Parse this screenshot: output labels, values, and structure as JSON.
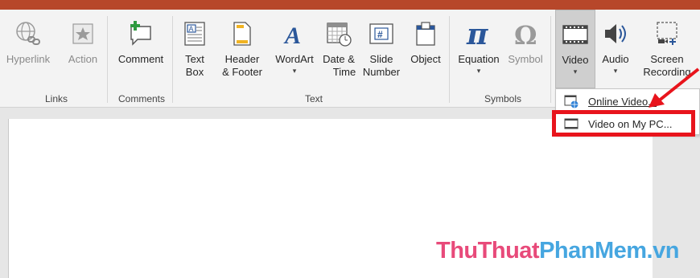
{
  "ribbon": {
    "groups": {
      "links": "Links",
      "comments": "Comments",
      "text": "Text",
      "symbols": "Symbols"
    },
    "buttons": {
      "hyperlink": "Hyperlink",
      "action": "Action",
      "comment": "Comment",
      "textbox_line1": "Text",
      "textbox_line2": "Box",
      "header_line1": "Header",
      "header_line2": "& Footer",
      "wordart": "WordArt",
      "datetime_line1": "Date &",
      "datetime_line2": "Time",
      "slidenumber_line1": "Slide",
      "slidenumber_line2": "Number",
      "object": "Object",
      "equation": "Equation",
      "symbol": "Symbol",
      "video": "Video",
      "audio": "Audio",
      "screen_line1": "Screen",
      "screen_line2": "Recording",
      "caret": "▾"
    },
    "colors": {
      "accent": "#b7472a",
      "wordart_blue": "#2b579a",
      "equation_blue": "#2b579a",
      "highlight_red": "#e8141c"
    }
  },
  "video_menu": {
    "online": "Online Video...",
    "on_pc": "Video on My PC..."
  },
  "watermark": {
    "part1": "ThuThuat",
    "part2": "PhanMem.vn"
  }
}
